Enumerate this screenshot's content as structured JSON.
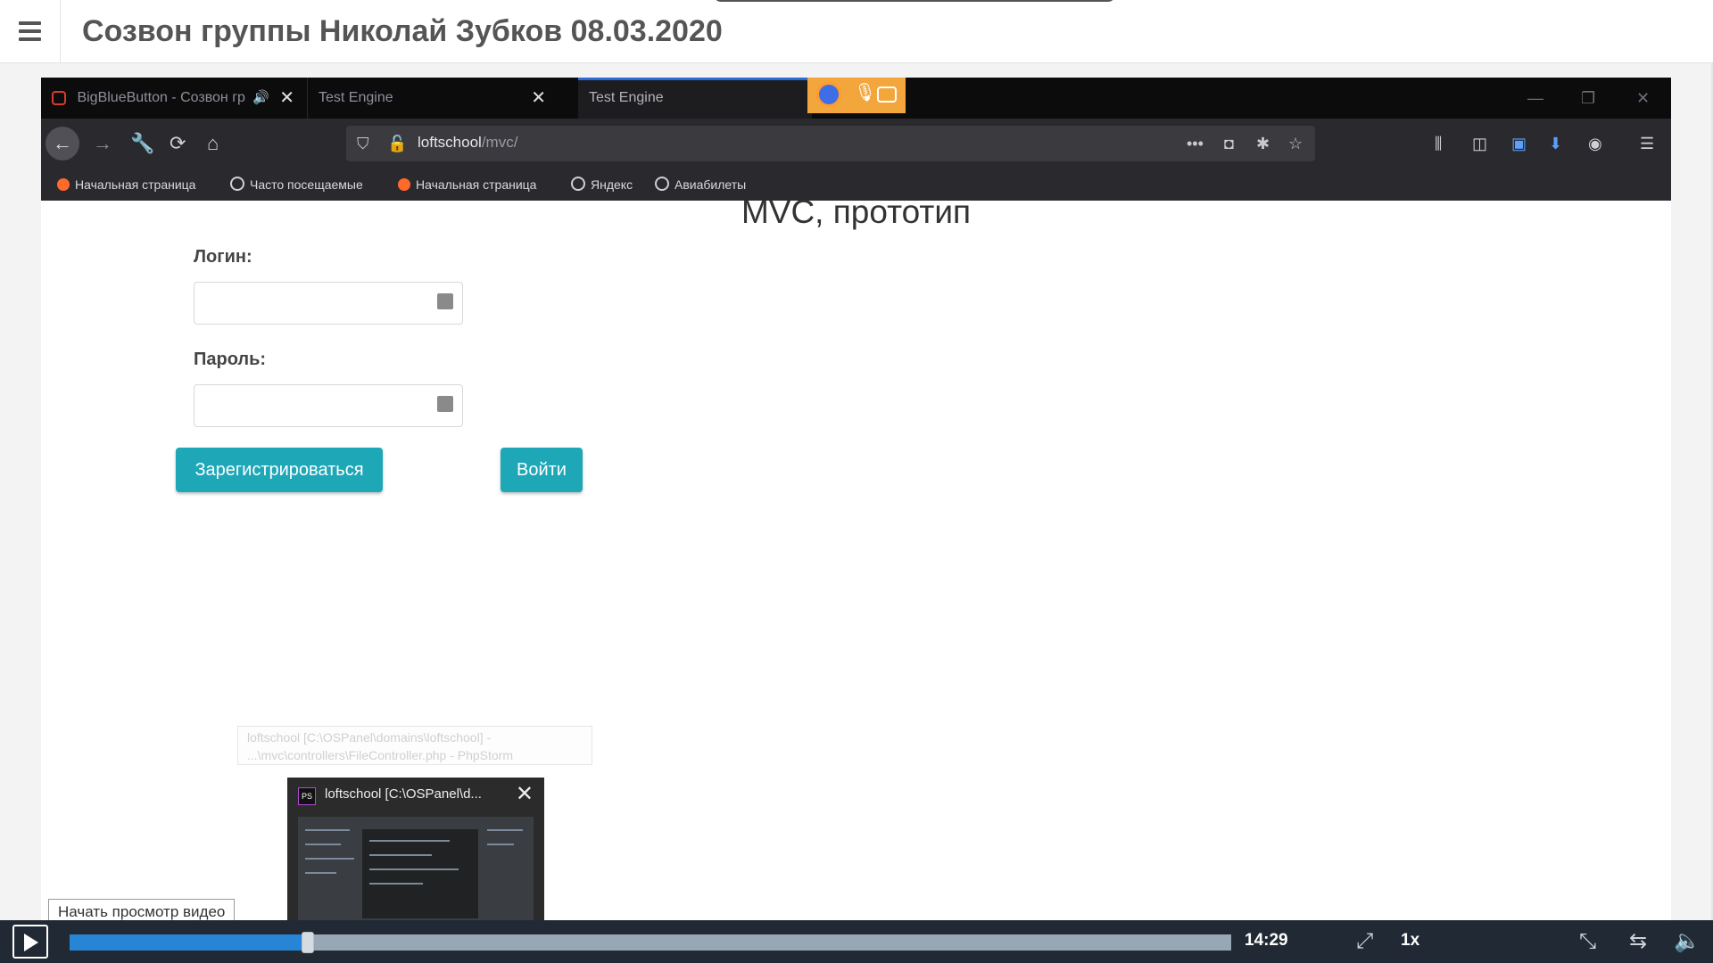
{
  "header": {
    "title": "Созвон группы Николай Зубков 08.03.2020"
  },
  "recorded_browser": {
    "tabs": [
      {
        "label": "BigBlueButton - Созвон гр"
      },
      {
        "label": "Test Engine"
      },
      {
        "label": "Test Engine"
      }
    ],
    "url_host": "loftschool",
    "url_path": "/mvc/",
    "bookmarks": [
      {
        "label": "Начальная страница"
      },
      {
        "label": "Часто посещаемые"
      },
      {
        "label": "Начальная страница"
      },
      {
        "label": "Яндекс"
      },
      {
        "label": "Авиабилеты"
      }
    ]
  },
  "recorded_page": {
    "heading": "MVC, прототип",
    "login_label": "Логин:",
    "password_label": "Пароль:",
    "register_button": "Зарегистрироваться",
    "login_button": "Войти"
  },
  "taskbar_preview": {
    "title": "loftschool [C:\\OSPanel\\d...",
    "ghost_tooltip": "loftschool [C:\\OSPanel\\domains\\loftschool] - ...\\mvc\\controllers\\FileController.php - PhpStorm"
  },
  "player": {
    "hint": "Начать просмотр видео",
    "time": "14:29",
    "speed": "1x",
    "progress": 0.205
  },
  "colors": {
    "accent_button": "#1ea7b7",
    "progress_fill": "#2785d6",
    "controls_bg": "#212a34"
  }
}
